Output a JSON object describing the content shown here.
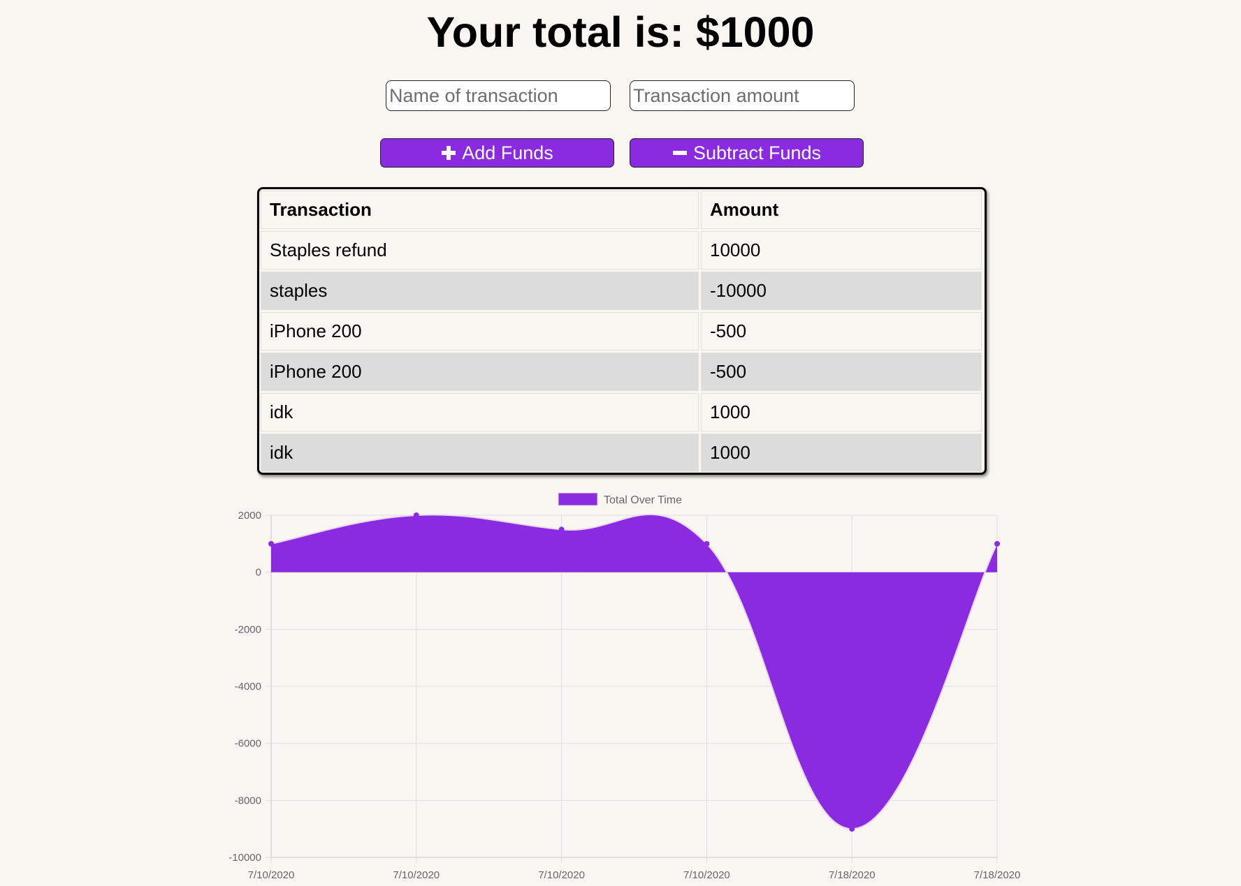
{
  "header": {
    "title": "Your total is: $1000"
  },
  "form": {
    "name_placeholder": "Name of transaction",
    "amount_placeholder": "Transaction amount",
    "add_label": "Add Funds",
    "subtract_label": "Subtract Funds"
  },
  "table": {
    "headers": [
      "Transaction",
      "Amount"
    ],
    "rows": [
      [
        "Staples refund",
        "10000"
      ],
      [
        "staples",
        "-10000"
      ],
      [
        "iPhone 200",
        "-500"
      ],
      [
        "iPhone 200",
        "-500"
      ],
      [
        "idk",
        "1000"
      ],
      [
        "idk",
        "1000"
      ]
    ]
  },
  "colors": {
    "accent": "#8a2be2",
    "background": "#f9f5f0"
  },
  "chart_data": {
    "type": "area",
    "x": [
      "7/10/2020",
      "7/10/2020",
      "7/10/2020",
      "7/10/2020",
      "7/18/2020",
      "7/18/2020"
    ],
    "series": [
      {
        "name": "Total Over Time",
        "values": [
          1000,
          2000,
          1500,
          1000,
          -9000,
          1000
        ],
        "color": "#8a2be2"
      }
    ],
    "ylim": [
      -10000,
      2000
    ],
    "yticks": [
      "2000",
      "0",
      "-2000",
      "-4000",
      "-6000",
      "-8000",
      "-10000"
    ],
    "grid": true,
    "legend": "top-center"
  }
}
